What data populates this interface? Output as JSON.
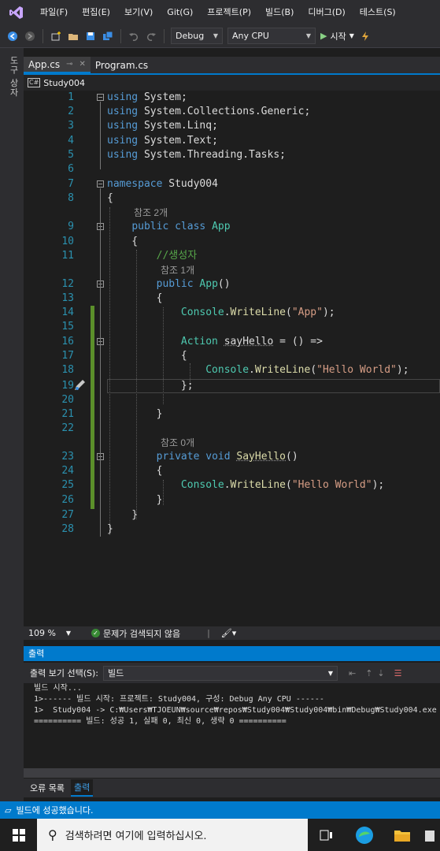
{
  "menu": [
    "파일(F)",
    "편집(E)",
    "보기(V)",
    "Git(G)",
    "프로젝트(P)",
    "빌드(B)",
    "디버그(D)",
    "테스트(S)"
  ],
  "toolbar": {
    "config": "Debug",
    "platform": "Any CPU",
    "start_label": "시작"
  },
  "left_strip_label": "도구 상자",
  "tabs": [
    {
      "label": "App.cs",
      "active": true
    },
    {
      "label": "Program.cs",
      "active": false
    }
  ],
  "navbar": {
    "cs_badge": "C#",
    "project": "Study004"
  },
  "code": {
    "line_numbers": [
      "1",
      "2",
      "3",
      "4",
      "5",
      "6",
      "7",
      "8",
      "9",
      "10",
      "11",
      "12",
      "13",
      "14",
      "15",
      "16",
      "17",
      "18",
      "19",
      "20",
      "21",
      "22",
      "23",
      "24",
      "25",
      "26",
      "27",
      "28"
    ],
    "ref_labels": [
      "참조 2개",
      "참조 1개",
      "참조 0개"
    ],
    "kw_using": "using",
    "kw_namespace": "namespace",
    "kw_public": "public",
    "kw_class": "class",
    "kw_private": "private",
    "kw_void": "void",
    "ns_system": "System",
    "ns_generic": "System.Collections.Generic",
    "ns_linq": "System.Linq",
    "ns_text": "System.Text",
    "ns_tasks": "System.Threading.Tasks",
    "namespace_name": "Study004",
    "class_name": "App",
    "comment": "//생성자",
    "console": "Console",
    "write_line": "WriteLine",
    "str_app": "\"App\"",
    "str_hello": "\"Hello World\"",
    "action_type": "Action",
    "var_name": "sayHello",
    "method_name": "SayHello"
  },
  "editor_status": {
    "zoom": "109 %",
    "issues": "문제가 검색되지 않음"
  },
  "output": {
    "header": "출력",
    "source_label": "출력 보기 선택(S):",
    "source_value": "빌드",
    "lines": [
      "빌드 시작...",
      "1>------ 빌드 시작: 프로젝트: Study004, 구성: Debug Any CPU ------",
      "1>  Study004 -> C:₩Users₩TJOEUN₩source₩repos₩Study004₩Study004₩bin₩Debug₩Study004.exe",
      "========== 빌드: 성공 1, 실패 0, 최신 0, 생략 0 =========="
    ],
    "tabs": [
      "오류 목록",
      "출력"
    ]
  },
  "status": {
    "message": "빌드에 성공했습니다."
  },
  "taskbar": {
    "search_placeholder": "검색하려면 여기에 입력하십시오."
  }
}
